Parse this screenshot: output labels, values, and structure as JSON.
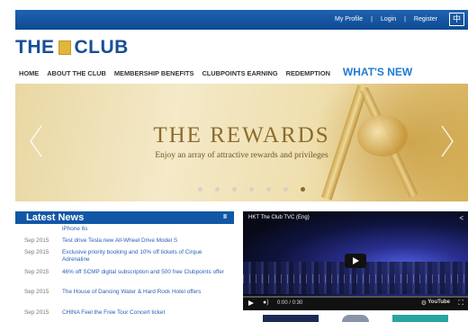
{
  "topbar": {
    "links": [
      "My Profile",
      "Login",
      "Register"
    ],
    "separator": "|",
    "language_button": "中"
  },
  "logo": {
    "left": "THE",
    "right": "CLUB"
  },
  "nav": {
    "items": [
      "HOME",
      "ABOUT THE CLUB",
      "MEMBERSHIP BENEFITS",
      "CLUBPOINTS EARNING",
      "REDEMPTION"
    ],
    "highlight": "WHAT'S NEW"
  },
  "banner": {
    "title": "THE REWARDS",
    "subtitle": "Enjoy an array of attractive rewards and privileges",
    "slide_count": 7,
    "active_slide": 7
  },
  "news": {
    "heading": "Latest News",
    "pause_icon": "II",
    "items": [
      {
        "date": "",
        "title": "iPhone 6s"
      },
      {
        "date": "Sep 2015",
        "title": "Test drive Tesla new All-Wheel Drive Model S"
      },
      {
        "date": "Sep 2015",
        "title": "Exclusive priority booking and 10% off tickets of Cirque Adrenaline"
      },
      {
        "date": "Sep 2015",
        "title": "46% off SCMP digital subscription and 500 free Clubpoints offer"
      },
      {
        "date": "Sep 2015",
        "title": "The House of Dancing Water & Hard Rock Hotel offers"
      },
      {
        "date": "Sep 2015",
        "title": "CHINA Feel the Free Tour Concert ticket"
      }
    ]
  },
  "video": {
    "title": "HKT The Club TVC (Eng)",
    "share_icon": "<",
    "time": "0:00 / 0:30",
    "brand": "YouTube",
    "colors": {
      "player_bg": "#0c1022"
    }
  },
  "colors": {
    "brand_blue": "#1157a6",
    "link_blue": "#2a62b6",
    "whats_new": "#1f7bd1",
    "gold": "#8c6b2c"
  }
}
